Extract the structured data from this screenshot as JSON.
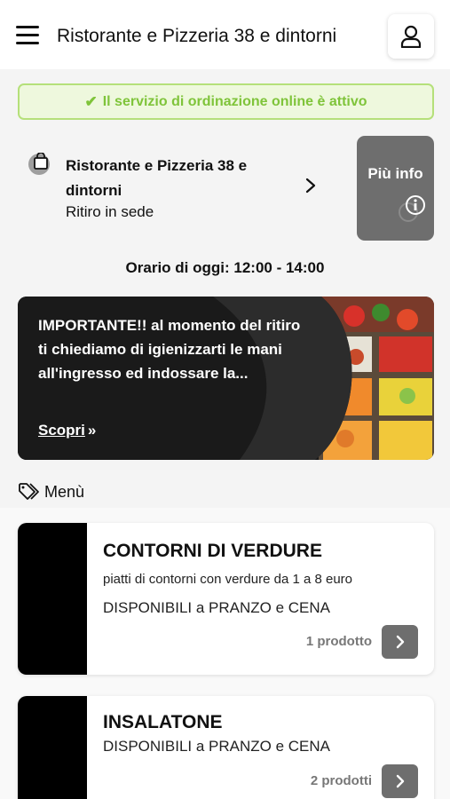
{
  "header": {
    "title": "Ristorante e Pizzeria 38 e dintorni",
    "menu_icon": "hamburger-icon",
    "user_icon": "user-icon"
  },
  "status": {
    "text": "Il servizio di ordinazione online è attivo",
    "icon": "check-icon",
    "color": "#7fc43a"
  },
  "store": {
    "name": "Ristorante e Pizzeria 38 e dintorni",
    "mode": "Ritiro in sede",
    "info_label": "Più info",
    "bag_icon": "shopping-bag-icon",
    "info_icon": "info-icon"
  },
  "hours": {
    "text": "Orario di oggi: 12:00 - 14:00"
  },
  "promo": {
    "text": "IMPORTANTE!! al momento del ritiro ti chiediamo di igienizzarti le mani all'ingresso ed indossare la...",
    "link_label": "Scopri",
    "link_icon": "double-chevron-right-icon"
  },
  "menu": {
    "label": "Menù",
    "icon": "tag-icon"
  },
  "categories": [
    {
      "title": "CONTORNI DI VERDURE",
      "description": "piatti di contorni con verdure da 1 a 8 euro",
      "availability": "DISPONIBILI a PRANZO e CENA",
      "count": "1 prodotto"
    },
    {
      "title": "INSALATONE",
      "availability": "DISPONIBILI a PRANZO e CENA",
      "count": "2 prodotti"
    }
  ],
  "colors": {
    "accent_gray": "#6e6e6e",
    "success_border": "#b5e07a",
    "success_bg": "#eef8dd"
  }
}
